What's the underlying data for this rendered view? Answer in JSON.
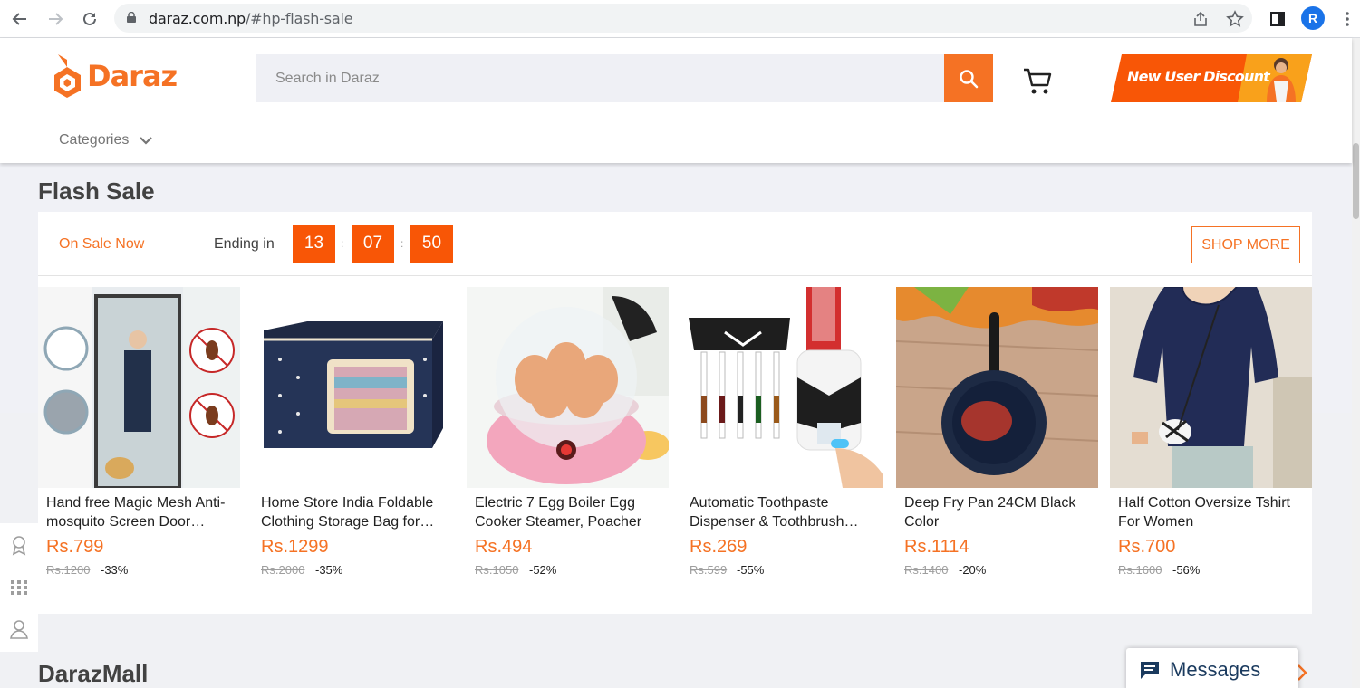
{
  "browser": {
    "url_host": "daraz.com.np",
    "url_path": "/#hp-flash-sale",
    "profile_initial": "R"
  },
  "header": {
    "logo_text": "Daraz",
    "search_placeholder": "Search in Daraz",
    "banner_text": "New User Discount",
    "categories_label": "Categories"
  },
  "flash_sale": {
    "title": "Flash Sale",
    "on_sale_label": "On Sale Now",
    "ending_label": "Ending in",
    "countdown": [
      "13",
      "07",
      "50"
    ],
    "shop_more_label": "SHOP MORE",
    "products": [
      {
        "name": "Hand free Magic Mesh Anti-mosquito Screen Door Curtain",
        "price": "Rs.799",
        "old_price": "Rs.1200",
        "discount": "-33%"
      },
      {
        "name": "Home Store India Foldable Clothing Storage Bag for Wardrobe",
        "price": "Rs.1299",
        "old_price": "Rs.2000",
        "discount": "-35%"
      },
      {
        "name": "Electric 7 Egg Boiler Egg Cooker Steamer, Poacher",
        "price": "Rs.494",
        "old_price": "Rs.1050",
        "discount": "-52%"
      },
      {
        "name": "Automatic Toothpaste Dispenser & Toothbrush Holder",
        "price": "Rs.269",
        "old_price": "Rs.599",
        "discount": "-55%"
      },
      {
        "name": "Deep Fry Pan 24CM Black Color",
        "price": "Rs.1114",
        "old_price": "Rs.1400",
        "discount": "-20%"
      },
      {
        "name": "Half Cotton Oversize Tshirt For Women",
        "price": "Rs.700",
        "old_price": "Rs.1600",
        "discount": "-56%"
      }
    ]
  },
  "mall": {
    "title": "DarazMall"
  },
  "messages": {
    "label": "Messages"
  },
  "colors": {
    "brand": "#f57224",
    "countdown": "#f85606"
  }
}
